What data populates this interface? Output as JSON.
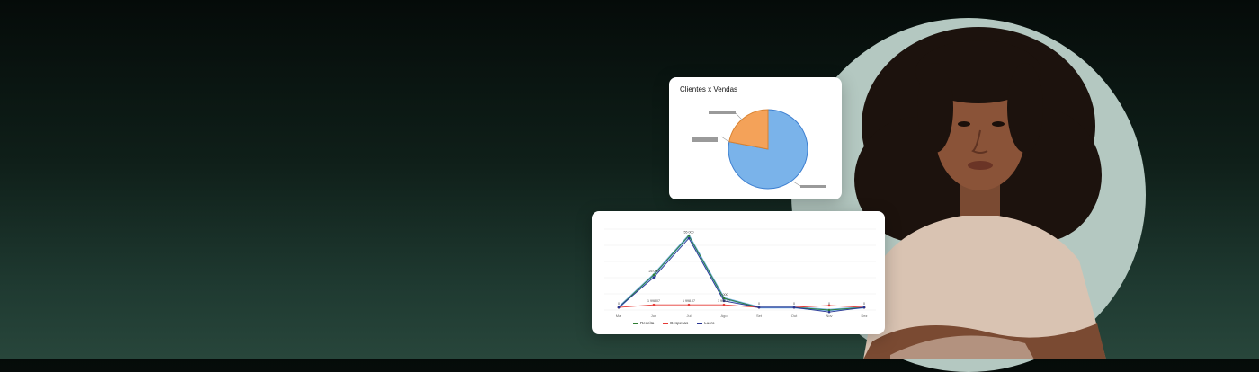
{
  "colors": {
    "receita": "#2e7d32",
    "despesas": "#e53935",
    "lucro": "#283593",
    "pie_blue": "#7ab3ea",
    "pie_orange": "#f4a259"
  },
  "pie_card": {
    "title": "Clientes x Vendas"
  },
  "chart_data": [
    {
      "type": "pie",
      "title": "Clientes x Vendas",
      "values": [
        78,
        22
      ]
    },
    {
      "type": "line",
      "categories": [
        "Mai",
        "Jun",
        "Jul",
        "Ago",
        "Set",
        "Out",
        "Nov",
        "Dez"
      ],
      "ylim": [
        -2000,
        60000
      ],
      "series": [
        {
          "name": "Receita",
          "values": [
            0,
            25000,
            55000,
            7000,
            0,
            0,
            -2000,
            0
          ]
        },
        {
          "name": "Despesas",
          "values": [
            0,
            1998.07,
            1998.07,
            1998.07,
            0,
            0,
            1500,
            0
          ]
        },
        {
          "name": "Lucro",
          "values": [
            0,
            23000,
            53000,
            5000,
            0,
            0,
            -3500,
            0
          ]
        }
      ],
      "data_labels": [
        "0",
        "25 000",
        "55 000",
        "7 000",
        "0",
        "0",
        "0",
        "0",
        "1 998.07",
        "1 998.07",
        "1 998.07"
      ],
      "legend": [
        "Receita",
        "Despesas",
        "Lucro"
      ]
    }
  ]
}
